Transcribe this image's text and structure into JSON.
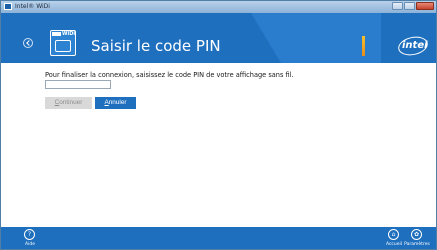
{
  "window": {
    "title": "Intel® WiDi"
  },
  "header": {
    "title": "Saisir le code PIN",
    "brand": "intel",
    "widi_logo_text": "WiDi"
  },
  "main": {
    "instruction": "Pour finaliser la connexion, saisissez le code PIN de votre affichage sans fil.",
    "pin_value": "",
    "continue_first": "C",
    "continue_rest": "ontinuer",
    "cancel_first": "A",
    "cancel_rest": "nnuler"
  },
  "footer": {
    "help_label": "Aide",
    "home_label": "Accueil",
    "settings_label": "Paramètres"
  },
  "colors": {
    "brand_blue": "#1f6fbf",
    "disabled_button": "#d9d9d9"
  }
}
